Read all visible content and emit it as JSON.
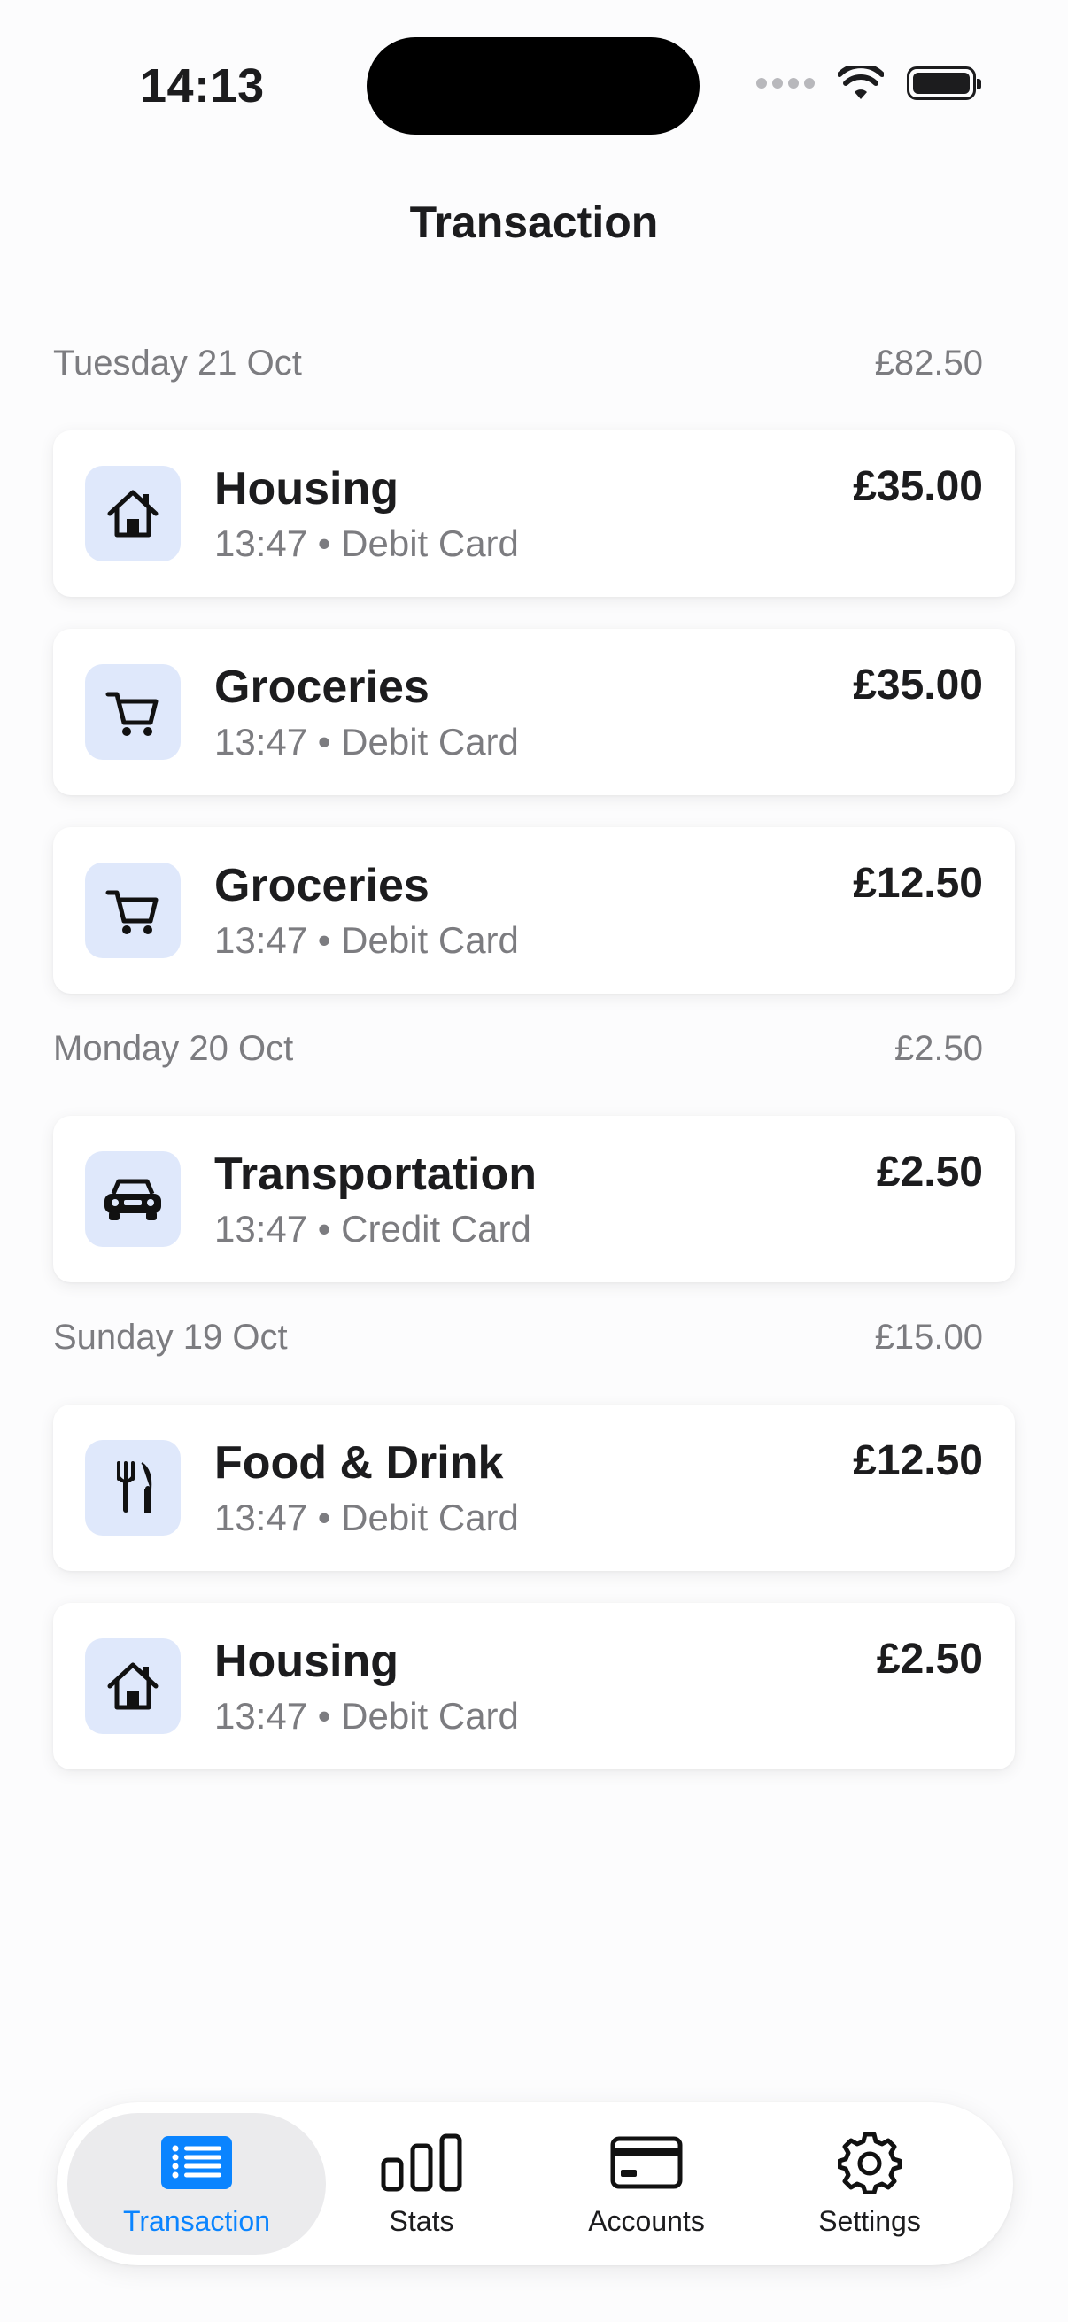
{
  "status_bar": {
    "time": "14:13"
  },
  "header": {
    "title": "Transaction"
  },
  "groups": [
    {
      "date": "Tuesday 21 Oct",
      "total": "£82.50",
      "transactions": [
        {
          "category": "Housing",
          "meta": "13:47 • Debit Card",
          "amount": "£35.00",
          "icon": "house-icon"
        },
        {
          "category": "Groceries",
          "meta": "13:47 • Debit Card",
          "amount": "£35.00",
          "icon": "cart-icon"
        },
        {
          "category": "Groceries",
          "meta": "13:47 • Debit Card",
          "amount": "£12.50",
          "icon": "cart-icon"
        }
      ]
    },
    {
      "date": "Monday 20 Oct",
      "total": "£2.50",
      "transactions": [
        {
          "category": "Transportation",
          "meta": "13:47 • Credit Card",
          "amount": "£2.50",
          "icon": "car-icon"
        }
      ]
    },
    {
      "date": "Sunday 19 Oct",
      "total": "£15.00",
      "transactions": [
        {
          "category": "Food & Drink",
          "meta": "13:47 • Debit Card",
          "amount": "£12.50",
          "icon": "fork-knife-icon"
        },
        {
          "category": "Housing",
          "meta": "13:47 • Debit Card",
          "amount": "£2.50",
          "icon": "house-icon"
        }
      ]
    }
  ],
  "tabbar": {
    "tabs": [
      {
        "label": "Transaction",
        "icon": "list-icon",
        "active": true
      },
      {
        "label": "Stats",
        "icon": "bar-chart-icon",
        "active": false
      },
      {
        "label": "Accounts",
        "icon": "credit-card-icon",
        "active": false
      },
      {
        "label": "Settings",
        "icon": "gear-icon",
        "active": false
      }
    ]
  },
  "colors": {
    "accent": "#0a84ff",
    "icon_tile": "#dfe8fb",
    "secondary_text": "#7c7c80",
    "active_tab_bg": "#ebebed"
  }
}
